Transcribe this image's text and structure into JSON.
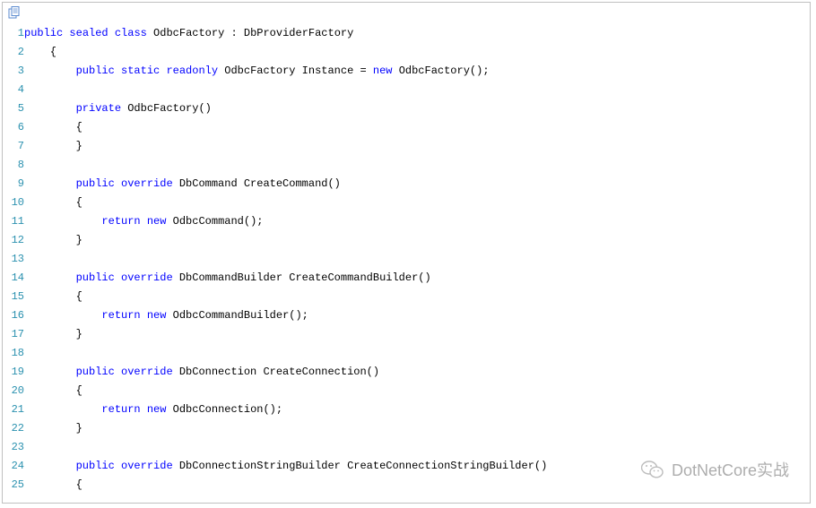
{
  "watermark": {
    "text": "DotNetCore实战"
  },
  "code": {
    "lines": [
      {
        "n": 1,
        "segs": [
          {
            "t": "public",
            "c": "kw"
          },
          {
            "t": " "
          },
          {
            "t": "sealed",
            "c": "kw"
          },
          {
            "t": " "
          },
          {
            "t": "class",
            "c": "kw"
          },
          {
            "t": " OdbcFactory : DbProviderFactory"
          }
        ]
      },
      {
        "n": 2,
        "segs": [
          {
            "t": "    {"
          }
        ]
      },
      {
        "n": 3,
        "segs": [
          {
            "t": "        "
          },
          {
            "t": "public",
            "c": "kw"
          },
          {
            "t": " "
          },
          {
            "t": "static",
            "c": "kw"
          },
          {
            "t": " "
          },
          {
            "t": "readonly",
            "c": "kw"
          },
          {
            "t": " OdbcFactory Instance = "
          },
          {
            "t": "new",
            "c": "kw"
          },
          {
            "t": " OdbcFactory();"
          }
        ]
      },
      {
        "n": 4,
        "segs": [
          {
            "t": ""
          }
        ]
      },
      {
        "n": 5,
        "segs": [
          {
            "t": "        "
          },
          {
            "t": "private",
            "c": "kw"
          },
          {
            "t": " OdbcFactory()"
          }
        ]
      },
      {
        "n": 6,
        "segs": [
          {
            "t": "        {"
          }
        ]
      },
      {
        "n": 7,
        "segs": [
          {
            "t": "        }"
          }
        ]
      },
      {
        "n": 8,
        "segs": [
          {
            "t": ""
          }
        ]
      },
      {
        "n": 9,
        "segs": [
          {
            "t": "        "
          },
          {
            "t": "public",
            "c": "kw"
          },
          {
            "t": " "
          },
          {
            "t": "override",
            "c": "kw"
          },
          {
            "t": " DbCommand CreateCommand()"
          }
        ]
      },
      {
        "n": 10,
        "segs": [
          {
            "t": "        {"
          }
        ]
      },
      {
        "n": 11,
        "segs": [
          {
            "t": "            "
          },
          {
            "t": "return",
            "c": "kw"
          },
          {
            "t": " "
          },
          {
            "t": "new",
            "c": "kw"
          },
          {
            "t": " OdbcCommand();"
          }
        ]
      },
      {
        "n": 12,
        "segs": [
          {
            "t": "        }"
          }
        ]
      },
      {
        "n": 13,
        "segs": [
          {
            "t": ""
          }
        ]
      },
      {
        "n": 14,
        "segs": [
          {
            "t": "        "
          },
          {
            "t": "public",
            "c": "kw"
          },
          {
            "t": " "
          },
          {
            "t": "override",
            "c": "kw"
          },
          {
            "t": " DbCommandBuilder CreateCommandBuilder()"
          }
        ]
      },
      {
        "n": 15,
        "segs": [
          {
            "t": "        {"
          }
        ]
      },
      {
        "n": 16,
        "segs": [
          {
            "t": "            "
          },
          {
            "t": "return",
            "c": "kw"
          },
          {
            "t": " "
          },
          {
            "t": "new",
            "c": "kw"
          },
          {
            "t": " OdbcCommandBuilder();"
          }
        ]
      },
      {
        "n": 17,
        "segs": [
          {
            "t": "        }"
          }
        ]
      },
      {
        "n": 18,
        "segs": [
          {
            "t": ""
          }
        ]
      },
      {
        "n": 19,
        "segs": [
          {
            "t": "        "
          },
          {
            "t": "public",
            "c": "kw"
          },
          {
            "t": " "
          },
          {
            "t": "override",
            "c": "kw"
          },
          {
            "t": " DbConnection CreateConnection()"
          }
        ]
      },
      {
        "n": 20,
        "segs": [
          {
            "t": "        {"
          }
        ]
      },
      {
        "n": 21,
        "segs": [
          {
            "t": "            "
          },
          {
            "t": "return",
            "c": "kw"
          },
          {
            "t": " "
          },
          {
            "t": "new",
            "c": "kw"
          },
          {
            "t": " OdbcConnection();"
          }
        ]
      },
      {
        "n": 22,
        "segs": [
          {
            "t": "        }"
          }
        ]
      },
      {
        "n": 23,
        "segs": [
          {
            "t": ""
          }
        ]
      },
      {
        "n": 24,
        "segs": [
          {
            "t": "        "
          },
          {
            "t": "public",
            "c": "kw"
          },
          {
            "t": " "
          },
          {
            "t": "override",
            "c": "kw"
          },
          {
            "t": " DbConnectionStringBuilder CreateConnectionStringBuilder()"
          }
        ]
      },
      {
        "n": 25,
        "segs": [
          {
            "t": "        {"
          }
        ]
      }
    ]
  }
}
